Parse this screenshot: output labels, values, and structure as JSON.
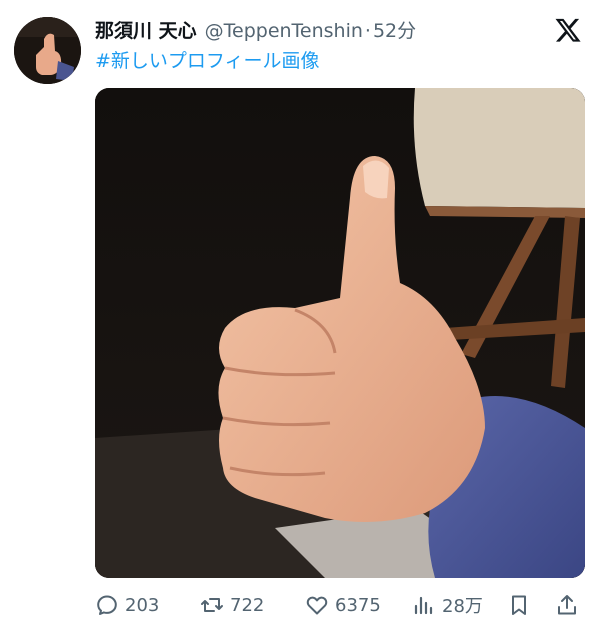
{
  "tweet": {
    "author_name": "那須川 天心",
    "handle": "@TeppenTenshin",
    "separator": "·",
    "time": "52分",
    "text": "#新しいプロフィール画像"
  },
  "actions": {
    "replies": "203",
    "retweets": "722",
    "likes": "6375",
    "views": "28万"
  },
  "colors": {
    "link": "#1d9bf0",
    "secondary_text": "#536471",
    "primary_text": "#0f1419"
  },
  "icons": [
    "x-logo-icon",
    "reply-icon",
    "retweet-icon",
    "like-icon",
    "views-icon",
    "bookmark-icon",
    "share-icon"
  ]
}
